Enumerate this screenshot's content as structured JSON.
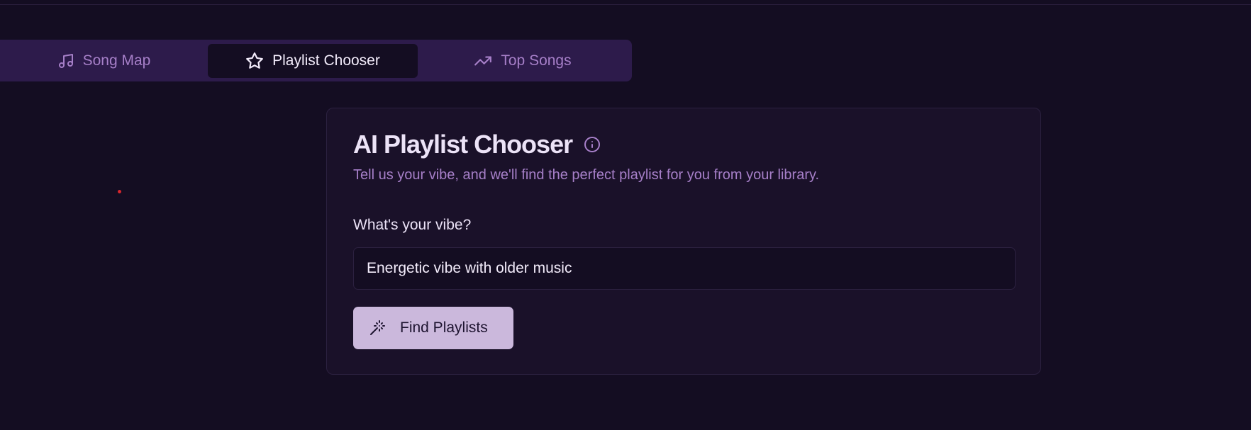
{
  "tabs": [
    {
      "label": "Song Map",
      "icon": "music-note-icon",
      "active": false
    },
    {
      "label": "Playlist Chooser",
      "icon": "star-icon",
      "active": true
    },
    {
      "label": "Top Songs",
      "icon": "trending-up-icon",
      "active": false
    }
  ],
  "card": {
    "title": "AI Playlist Chooser",
    "info_icon": "info-icon",
    "subtitle": "Tell us your vibe, and we'll find the perfect playlist for you from your library.",
    "vibe_label": "What's your vibe?",
    "vibe_value": "Energetic vibe with older music",
    "button_label": "Find Playlists",
    "button_icon": "magic-wand-icon"
  },
  "colors": {
    "background": "#140d22",
    "tab_bar": "#2d1b4b",
    "accent_text": "#a67fc8",
    "button_bg": "#cbb8dc",
    "cursor_dot": "#d7262d"
  }
}
